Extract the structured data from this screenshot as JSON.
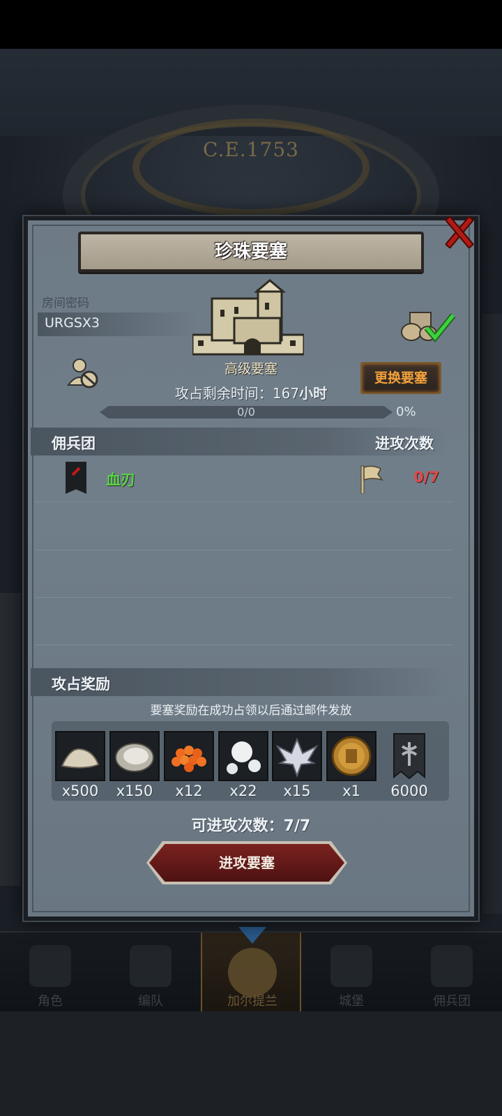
{
  "background": {
    "era_label": "C.E.1753"
  },
  "dialog": {
    "title": "珍珠要塞",
    "room": {
      "label": "房间密码",
      "code": "URGSX3"
    },
    "fort_level": "高级要塞",
    "change_button": "更换要塞",
    "occupy_time": {
      "label": "攻占剩余时间：",
      "value": "167",
      "unit": "小时"
    },
    "progress": {
      "text": "0/0",
      "percent_label": "0%",
      "fraction": 0
    },
    "merc_section": {
      "title": "佣兵团",
      "attacks_header": "进攻次数"
    },
    "mercenaries": [
      {
        "name": "血刃",
        "attacks": "0/7"
      }
    ],
    "rewards_section": {
      "title": "攻占奖励",
      "note": "要塞奖励在成功占领以后通过邮件发放",
      "items": [
        {
          "icon": "sand-pile-icon",
          "qty": "x500"
        },
        {
          "icon": "oyster-icon",
          "qty": "x150"
        },
        {
          "icon": "roe-icon",
          "qty": "x12"
        },
        {
          "icon": "pearl-icon",
          "qty": "x22"
        },
        {
          "icon": "wing-emblem-icon",
          "qty": "x15"
        },
        {
          "icon": "knight-coin-icon",
          "qty": "x1"
        },
        {
          "icon": "axe-banner-icon",
          "qty": "6000"
        }
      ]
    },
    "attack_count": {
      "label": "可进攻次数：",
      "value": "7/7"
    },
    "attack_button": "进攻要塞"
  },
  "bottom_nav": [
    {
      "label": "角色",
      "active": false
    },
    {
      "label": "编队",
      "active": false
    },
    {
      "label": "加尔提兰",
      "active": true
    },
    {
      "label": "城堡",
      "active": false
    },
    {
      "label": "佣兵团",
      "active": false
    }
  ],
  "colors": {
    "merc_name": "#5bd24a",
    "attacks_count": "#e04a4a",
    "change_button_text": "#f3a23a",
    "close_red": "#b41a14"
  }
}
